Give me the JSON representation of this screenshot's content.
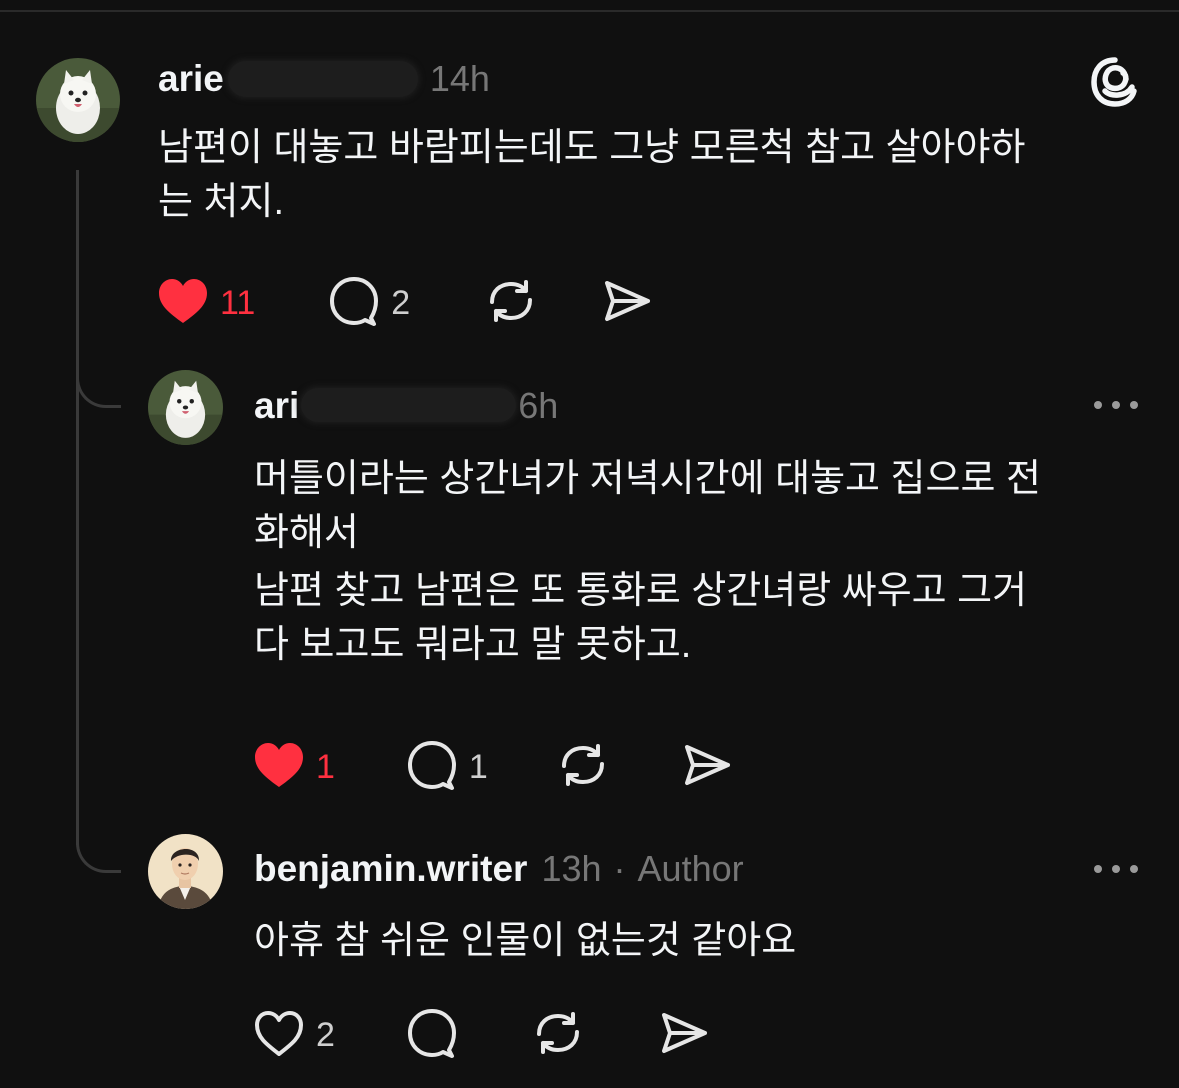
{
  "colors": {
    "background": "#101010",
    "text": "#f3f5f7",
    "muted": "#777777",
    "like": "#ff3040",
    "line": "#3a3a3a"
  },
  "icons": {
    "app_logo": "threads-logo-icon",
    "like": "heart-icon",
    "reply": "speech-bubble-icon",
    "repost": "repost-arrows-icon",
    "share": "paper-plane-icon",
    "more": "more-dots-icon"
  },
  "posts": [
    {
      "username": "arie",
      "time": "14h",
      "lines": [
        "남편이 대놓고 바람피는데도 그냥 모른척 참고 살아야하",
        "는 처지."
      ],
      "likes": "11",
      "liked": true,
      "replies": "2"
    },
    {
      "username": "ari",
      "time": "6h",
      "lines": [
        "머틀이라는 상간녀가 저녁시간에 대놓고 집으로 전",
        "화해서",
        "남편 찾고 남편은 또 통화로 상간녀랑 싸우고 그거",
        "다 보고도 뭐라고 말 못하고."
      ],
      "likes": "1",
      "liked": true,
      "replies": "1"
    },
    {
      "username": "benjamin.writer",
      "time": "13h",
      "separator": "·",
      "badge": "Author",
      "lines": [
        "아휴 참 쉬운 인물이 없는것 같아요"
      ],
      "likes": "2",
      "liked": false,
      "replies": ""
    }
  ]
}
